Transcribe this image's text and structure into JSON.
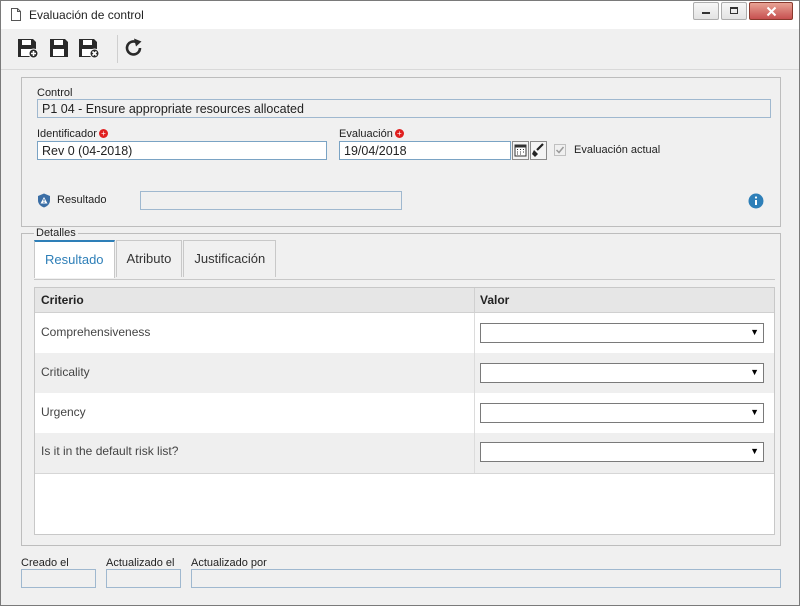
{
  "window": {
    "title": "Evaluación de control"
  },
  "form": {
    "control_label": "Control",
    "control_value": "P1 04 - Ensure appropriate resources allocated",
    "identificador_label": "Identificador",
    "identificador_value": "Rev 0 (04-2018)",
    "evaluacion_label": "Evaluación",
    "evaluacion_value": "19/04/2018",
    "evaluacion_actual_label": "Evaluación actual",
    "resultado_label": "Resultado",
    "resultado_value": ""
  },
  "details": {
    "legend": "Detalles",
    "tabs": [
      {
        "label": "Resultado"
      },
      {
        "label": "Atributo"
      },
      {
        "label": "Justificación"
      }
    ],
    "columns": {
      "criterio": "Criterio",
      "valor": "Valor"
    },
    "rows": [
      {
        "criterio": "Comprehensiveness",
        "valor": ""
      },
      {
        "criterio": "Criticality",
        "valor": ""
      },
      {
        "criterio": "Urgency",
        "valor": ""
      },
      {
        "criterio": "Is it in the default risk list?",
        "valor": ""
      }
    ]
  },
  "footer": {
    "creado_label": "Creado el",
    "creado_value": "",
    "actualizado_label": "Actualizado el",
    "actualizado_value": "",
    "actualizado_por_label": "Actualizado por",
    "actualizado_por_value": ""
  },
  "colors": {
    "accent": "#2e7fb8",
    "required": "#e02020"
  }
}
